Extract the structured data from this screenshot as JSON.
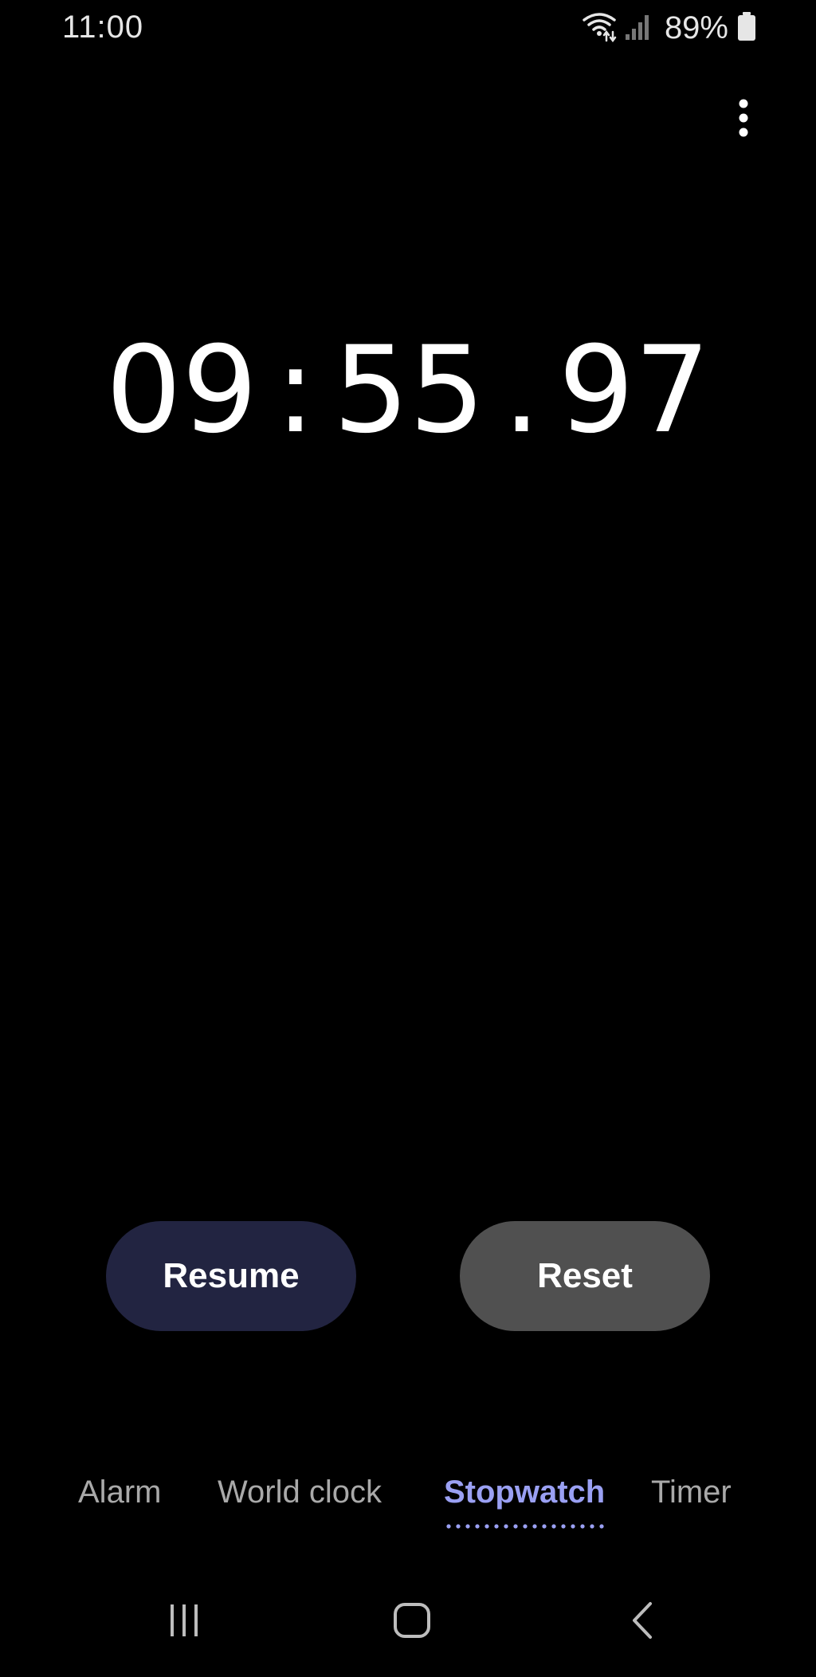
{
  "status_bar": {
    "time": "11:00",
    "battery_percent": "89%",
    "icons": [
      "wifi-icon",
      "signal-icon",
      "battery-icon"
    ]
  },
  "menu": {
    "icon": "more-vertical-icon"
  },
  "stopwatch": {
    "minutes": "09",
    "minutes_separator": ":",
    "seconds": "55",
    "seconds_separator": ".",
    "hundredths": "97"
  },
  "buttons": {
    "resume_label": "Resume",
    "reset_label": "Reset"
  },
  "tabs": [
    {
      "label": "Alarm",
      "active": false
    },
    {
      "label": "World clock",
      "active": false
    },
    {
      "label": "Stopwatch",
      "active": true
    },
    {
      "label": "Timer",
      "active": false
    }
  ],
  "nav_bar": {
    "icons": [
      "recent-apps-icon",
      "home-icon",
      "back-icon"
    ]
  },
  "colors": {
    "background": "#000000",
    "resume_button": "#222441",
    "reset_button": "#505050",
    "accent": "#9aa0f3",
    "tab_inactive": "#a9a9a9"
  }
}
